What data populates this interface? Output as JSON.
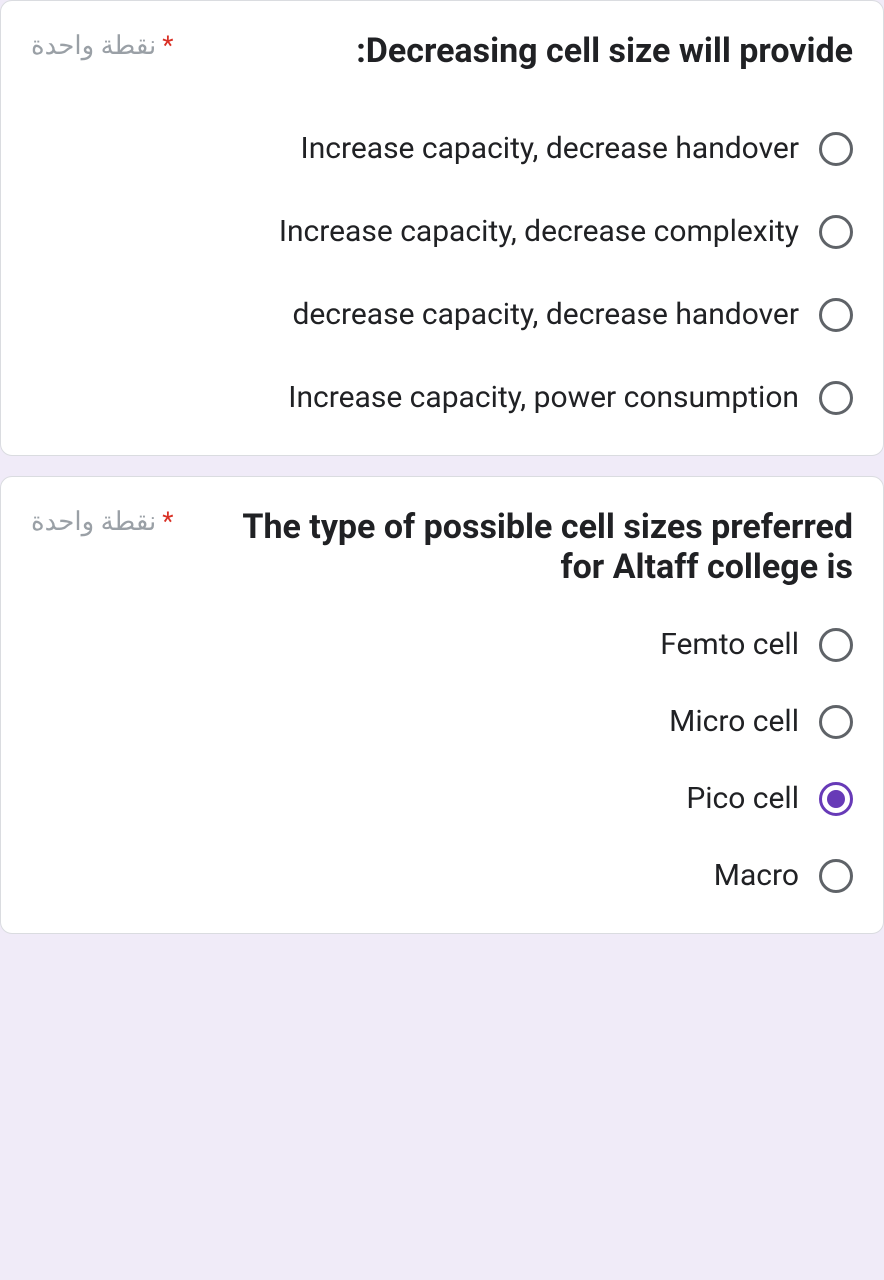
{
  "questions": [
    {
      "points_label": "نقطة واحدة",
      "required_marker": "*",
      "title": ":Decreasing cell size will provide",
      "options": [
        {
          "label": "Increase capacity, decrease handover",
          "selected": false
        },
        {
          "label": "Increase capacity, decrease complexity",
          "selected": false
        },
        {
          "label": "decrease capacity, decrease handover",
          "selected": false
        },
        {
          "label": "Increase capacity, power consumption",
          "selected": false
        }
      ]
    },
    {
      "points_label": "نقطة واحدة",
      "required_marker": "*",
      "title": "The type of possible cell sizes preferred for Altaff college is",
      "options": [
        {
          "label": "Femto cell",
          "selected": false
        },
        {
          "label": "Micro cell",
          "selected": false
        },
        {
          "label": "Pico cell",
          "selected": true
        },
        {
          "label": "Macro",
          "selected": false
        }
      ]
    }
  ]
}
